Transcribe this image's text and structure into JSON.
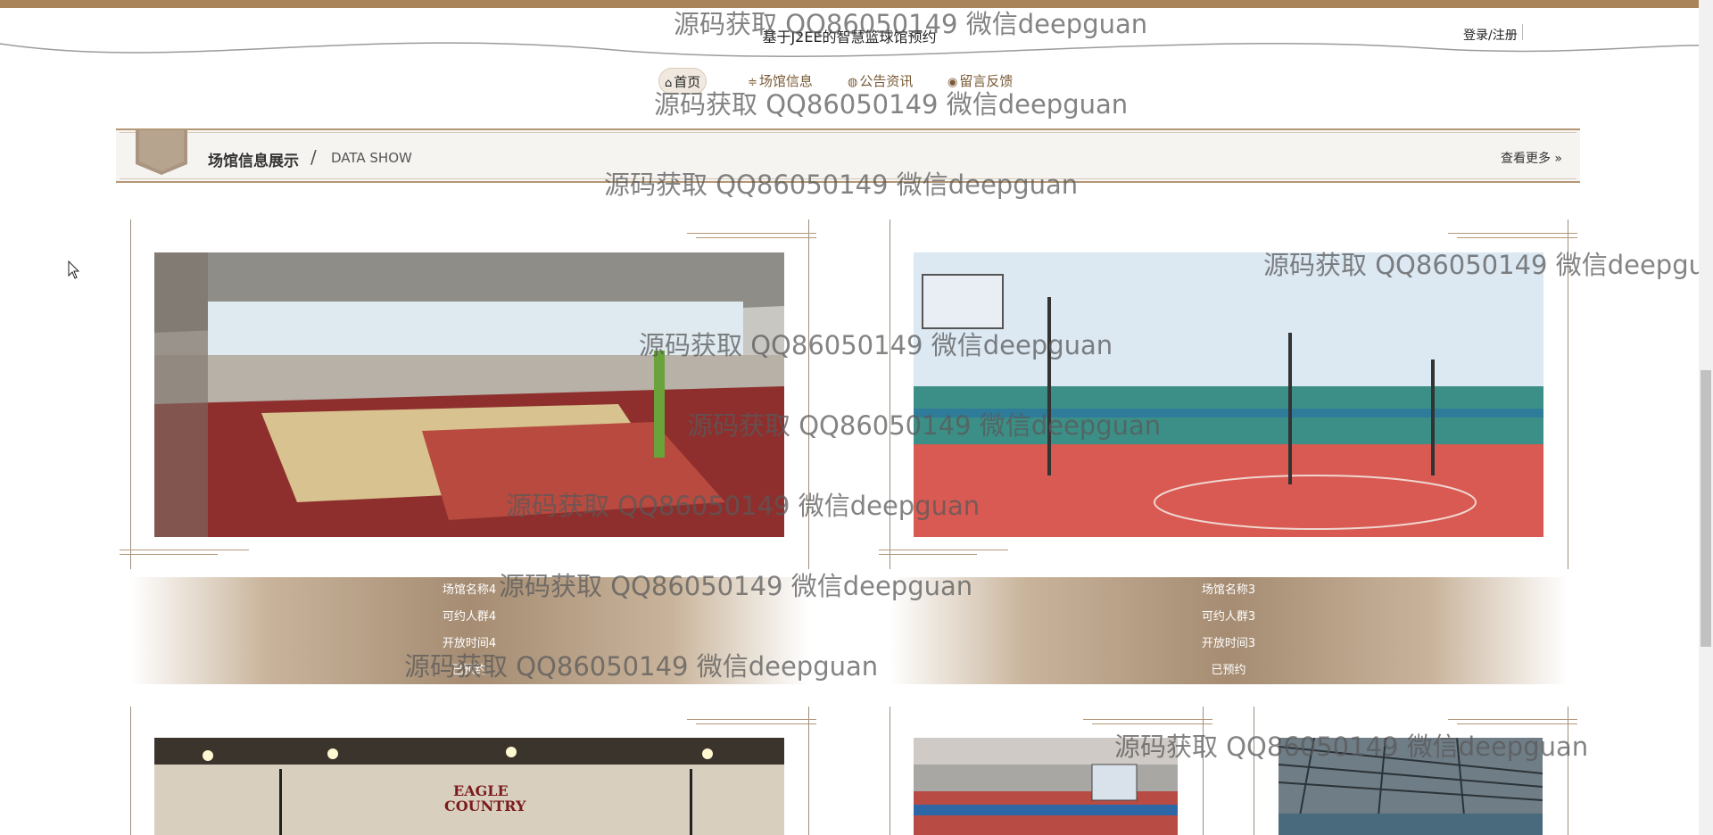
{
  "header": {
    "site_title": "基于J2EE的智慧篮球馆预约",
    "login_label": "登录/注册"
  },
  "nav": {
    "items": [
      {
        "label": "首页",
        "icon": "home-icon"
      },
      {
        "label": "场馆信息",
        "icon": "sliders-icon"
      },
      {
        "label": "公告资讯",
        "icon": "palette-icon"
      },
      {
        "label": "留言反馈",
        "icon": "chat-icon"
      }
    ]
  },
  "section": {
    "title": "场馆信息展示",
    "separator": "/",
    "subtitle": "DATA SHOW",
    "more_label": "查看更多 »"
  },
  "venues": [
    {
      "name": "场馆名称4",
      "capacity": "可约人群4",
      "hours": "开放时间4",
      "status": "已预约"
    },
    {
      "name": "场馆名称3",
      "capacity": "可约人群3",
      "hours": "开放时间3",
      "status": "已预约"
    }
  ],
  "watermark": "源码获取 QQ86050149 微信deepguan",
  "colors": {
    "accent": "#a9845a",
    "band": "#a58c72",
    "nav_text": "#7a5a36"
  }
}
